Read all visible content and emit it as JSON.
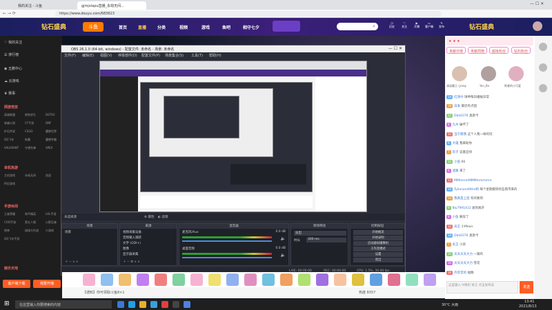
{
  "browser": {
    "tabs": [
      {
        "label": "我的关注 - 斗鱼"
      },
      {
        "label": "gjmjxiapu直播_永劫无间..."
      }
    ],
    "url": "https://www.douyu.com/683623"
  },
  "site": {
    "logo": "斗鱼",
    "nav": [
      "首页",
      "直播",
      "分类",
      "视频",
      "游戏",
      "鱼吧",
      "相守七夕"
    ],
    "header_icons": [
      "历史",
      "关注",
      "开播",
      "客户端",
      "发布"
    ],
    "banner_text": "钻石盛典"
  },
  "sidebar": {
    "items": [
      "我的关注",
      "排行榜",
      "五鹏中心",
      "云游戏",
      "赛事"
    ],
    "sections": [
      {
        "title": "网游竞技",
        "cells": [
          "英雄联盟",
          "绝地求生",
          "DOTA2",
          "穿越火线",
          "CF手游",
          "DNF",
          "炉石传说",
          "CSGO",
          "魔兽世界",
          "QQ飞车",
          "街霸",
          "魔兽争霸",
          "VALORANT",
          "守望先锋",
          "APEX"
        ]
      },
      {
        "title": "单机热游",
        "cells": [
          "主机游戏",
          "永劫无间",
          "逆战",
          "怀旧游戏"
        ]
      },
      {
        "title": "手游休闲",
        "cells": [
          "王者荣耀",
          "和平精英",
          "LOL手游",
          "COD手游",
          "第五人格",
          "火影忍者",
          "原神",
          "球球大作战",
          "小游戏",
          "QQ飞车手游"
        ]
      },
      {
        "title": "娱乐天地"
      }
    ],
    "bottom_buttons": [
      "客户端下载",
      "我要开播"
    ]
  },
  "obs": {
    "title": "OBS 26.1.0 (64-bit, windows) - 配置文件: 未命名 - 场景: 未命名",
    "menu": [
      "文件(F)",
      "编辑(E)",
      "视图(V)",
      "停靠部件(D)",
      "配置文件(P)",
      "场景集合(S)",
      "工具(T)",
      "帮助(H)"
    ],
    "no_source": "未选择源",
    "scenes_toolbar": [
      "属性",
      "滤镜"
    ],
    "panels": {
      "scenes": "场景",
      "sources": "来源",
      "mixer": "混音器",
      "transitions": "转场特效",
      "controls": "控制按钮"
    },
    "scene_list": [
      "场景"
    ],
    "source_list": [
      "视频采集设备",
      "音频输入捕获",
      "文字 (GDI+)",
      "图像",
      "显示器采集"
    ],
    "mixer_tracks": [
      {
        "name": "麦克风/Aux",
        "db": "0.0 dB"
      },
      {
        "name": "桌面音频",
        "db": "0.0 dB"
      }
    ],
    "transition": {
      "type": "淡出",
      "duration_label": "时长",
      "duration": "300 ms"
    },
    "controls": [
      "开始推流",
      "开始录制",
      "启动虚拟摄像机",
      "工作室模式",
      "设置",
      "退出"
    ],
    "status": {
      "live": "LIVE: 00:00:00",
      "rec": "REC: 00:00:00",
      "cpu": "CPU: 1.5%, 30.00 fps"
    }
  },
  "stream": {
    "room_info": "【通知】你可领取斗鱼8×1",
    "viewers": "热度 8357",
    "gifts": [
      "荧光棒",
      "办卡",
      "飞机",
      "火箭",
      "超级火箭",
      "摩天大厦",
      "鱼丸",
      "宝箱"
    ]
  },
  "chat": {
    "tabs": [
      "贡献日榜",
      "贡献周榜",
      "超级粉丝",
      "钻石粉丝"
    ],
    "top_ranked": [
      "清溪霸王 (yang",
      "Yan_Bo",
      "陈睿的小可爱"
    ],
    "messages": [
      {
        "level": "14",
        "user": "红领巾",
        "text": "球神每日播报日常"
      },
      {
        "level": "16",
        "user": "白发",
        "text": "最近有点困"
      },
      {
        "level": "21",
        "user": "Dda0376",
        "text": "奥斯卡"
      },
      {
        "level": "8",
        "user": "九州",
        "text": "破坏了"
      },
      {
        "level": "12",
        "user": "当宁愿我",
        "text": "这个人我一样的玩"
      },
      {
        "level": "9",
        "user": "大雄",
        "text": "我来助你"
      },
      {
        "level": "7",
        "user": "欢子",
        "text": "竞嘉丑绿"
      },
      {
        "level": "11",
        "user": "小鱼",
        "text": "66"
      },
      {
        "level": "6",
        "user": "迷路",
        "text": "来了"
      },
      {
        "level": "15",
        "user": "MMmmmMMMmmmmm",
        "text": ""
      },
      {
        "level": "10",
        "user": "TylianandWire和",
        "text": "每个星期都到有些雨市来的"
      },
      {
        "level": "13",
        "user": "我真是上后",
        "text": "有的要到"
      },
      {
        "level": "9",
        "user": "Bly7991412",
        "text": "速到离开"
      },
      {
        "level": "8",
        "user": "小鱼",
        "text": "敏穿了"
      },
      {
        "level": "12",
        "user": "贡王",
        "text": "小Mean"
      },
      {
        "level": "14",
        "user": "Dda0376",
        "text": "奥斯卡"
      },
      {
        "level": "7",
        "user": "贡王",
        "text": "小孩"
      },
      {
        "level": "11",
        "user": "天天天天大力",
        "text": "一跟鸡"
      },
      {
        "level": "10",
        "user": "天天天天大力",
        "text": "雪花"
      },
      {
        "level": "16",
        "user": "齐欢音的",
        "text": "福晚"
      }
    ],
    "input_placeholder": "这里输入'#精彩'发言 点击发布说",
    "send": "发送"
  },
  "taskbar": {
    "search_placeholder": "在这里输入你要搜索的内容",
    "weather": "30°C 大雨",
    "time": "13:41",
    "date": "2021/8/13"
  },
  "colors": {
    "accent": "#ff5d23",
    "obs_bg": "#2b2e38",
    "brand_purple": "#3c1f7a"
  }
}
